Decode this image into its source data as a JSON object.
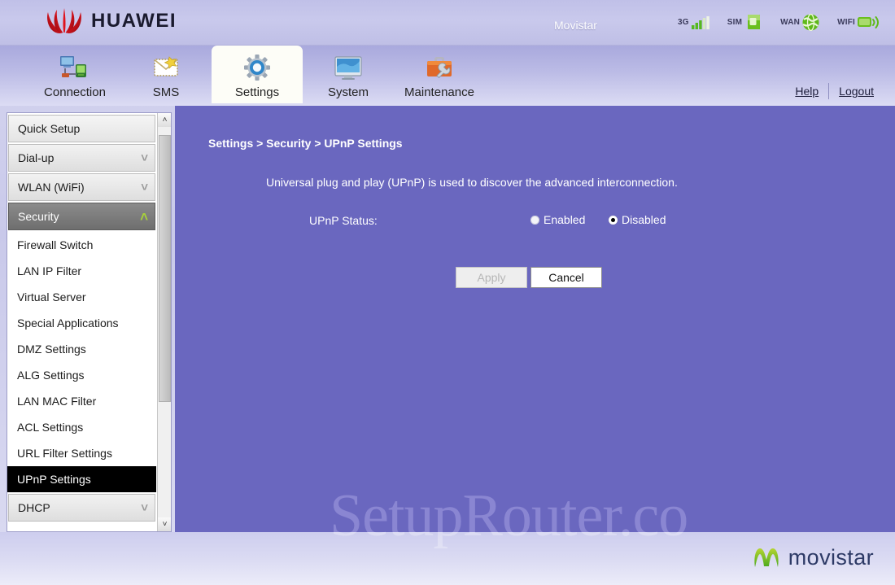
{
  "header": {
    "brand": "HUAWEI",
    "carrier": "Movistar",
    "status_icons": [
      {
        "label": "3G",
        "icon": "signal-bars-icon"
      },
      {
        "label": "SIM",
        "icon": "sim-card-icon"
      },
      {
        "label": "WAN",
        "icon": "globe-icon"
      },
      {
        "label": "WIFI",
        "icon": "wifi-icon"
      }
    ]
  },
  "nav": {
    "tabs": [
      {
        "label": "Connection",
        "icon": "network-computers-icon",
        "active": false
      },
      {
        "label": "SMS",
        "icon": "envelope-icon",
        "active": false
      },
      {
        "label": "Settings",
        "icon": "gear-icon",
        "active": true
      },
      {
        "label": "System",
        "icon": "monitor-icon",
        "active": false
      },
      {
        "label": "Maintenance",
        "icon": "toolbox-wrench-icon",
        "active": false
      }
    ],
    "help_label": "Help",
    "logout_label": "Logout"
  },
  "sidebar": {
    "entries": [
      {
        "type": "group",
        "label": "Quick Setup",
        "state": "none",
        "chevron": ""
      },
      {
        "type": "group",
        "label": "Dial-up",
        "state": "closed",
        "chevron": "˅"
      },
      {
        "type": "group",
        "label": "WLAN (WiFi)",
        "state": "closed",
        "chevron": "˅"
      },
      {
        "type": "group",
        "label": "Security",
        "state": "open",
        "chevron": "˄"
      },
      {
        "type": "item",
        "label": "Firewall Switch",
        "selected": false
      },
      {
        "type": "item",
        "label": "LAN IP Filter",
        "selected": false
      },
      {
        "type": "item",
        "label": "Virtual Server",
        "selected": false
      },
      {
        "type": "item",
        "label": "Special Applications",
        "selected": false
      },
      {
        "type": "item",
        "label": "DMZ Settings",
        "selected": false
      },
      {
        "type": "item",
        "label": "ALG Settings",
        "selected": false
      },
      {
        "type": "item",
        "label": "LAN MAC Filter",
        "selected": false
      },
      {
        "type": "item",
        "label": "ACL Settings",
        "selected": false
      },
      {
        "type": "item",
        "label": "URL Filter Settings",
        "selected": false
      },
      {
        "type": "item",
        "label": "UPnP Settings",
        "selected": true
      },
      {
        "type": "group",
        "label": "DHCP",
        "state": "closed",
        "chevron": "˅"
      }
    ],
    "scroll_up": "˄",
    "scroll_down": "˅"
  },
  "main": {
    "breadcrumb": "Settings > Security > UPnP Settings",
    "description": "Universal plug and play (UPnP) is used to discover the advanced interconnection.",
    "status_label": "UPnP Status:",
    "options": [
      {
        "label": "Enabled",
        "checked": false
      },
      {
        "label": "Disabled",
        "checked": true
      }
    ],
    "apply_label": "Apply",
    "cancel_label": "Cancel",
    "apply_disabled": true
  },
  "footer": {
    "brand": "movistar"
  },
  "watermark": {
    "text": "SetupRouter.co"
  },
  "colors": {
    "main_bg": "#6a67bf",
    "header_bg": "#c4c4ea",
    "selected_item_bg": "#000000",
    "open_group_bg": "#6e6e6e",
    "accent_green": "#7dc014",
    "movistar_blue": "#2d3a66"
  }
}
